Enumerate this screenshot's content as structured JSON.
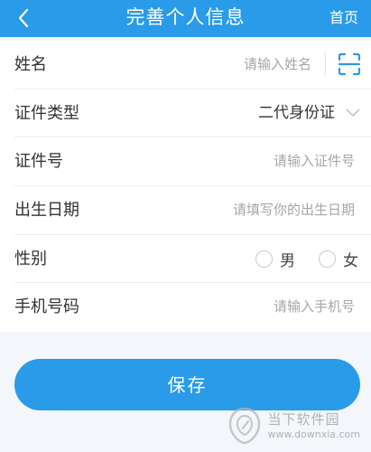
{
  "header": {
    "title": "完善个人信息",
    "home_label": "首页"
  },
  "form": {
    "name": {
      "label": "姓名",
      "placeholder": "请输入姓名"
    },
    "id_type": {
      "label": "证件类型",
      "value": "二代身份证"
    },
    "id_number": {
      "label": "证件号",
      "placeholder": "请输入证件号"
    },
    "birth_date": {
      "label": "出生日期",
      "placeholder": "请填写你的出生日期"
    },
    "gender": {
      "label": "性别",
      "options": [
        "男",
        "女"
      ]
    },
    "phone": {
      "label": "手机号码",
      "placeholder": "请输入手机号"
    }
  },
  "save_label": "保存",
  "watermark": {
    "text": "当下软件园",
    "url": "www.downxia.com"
  },
  "colors": {
    "accent": "#2a9be8",
    "background": "#f3f6fa"
  }
}
